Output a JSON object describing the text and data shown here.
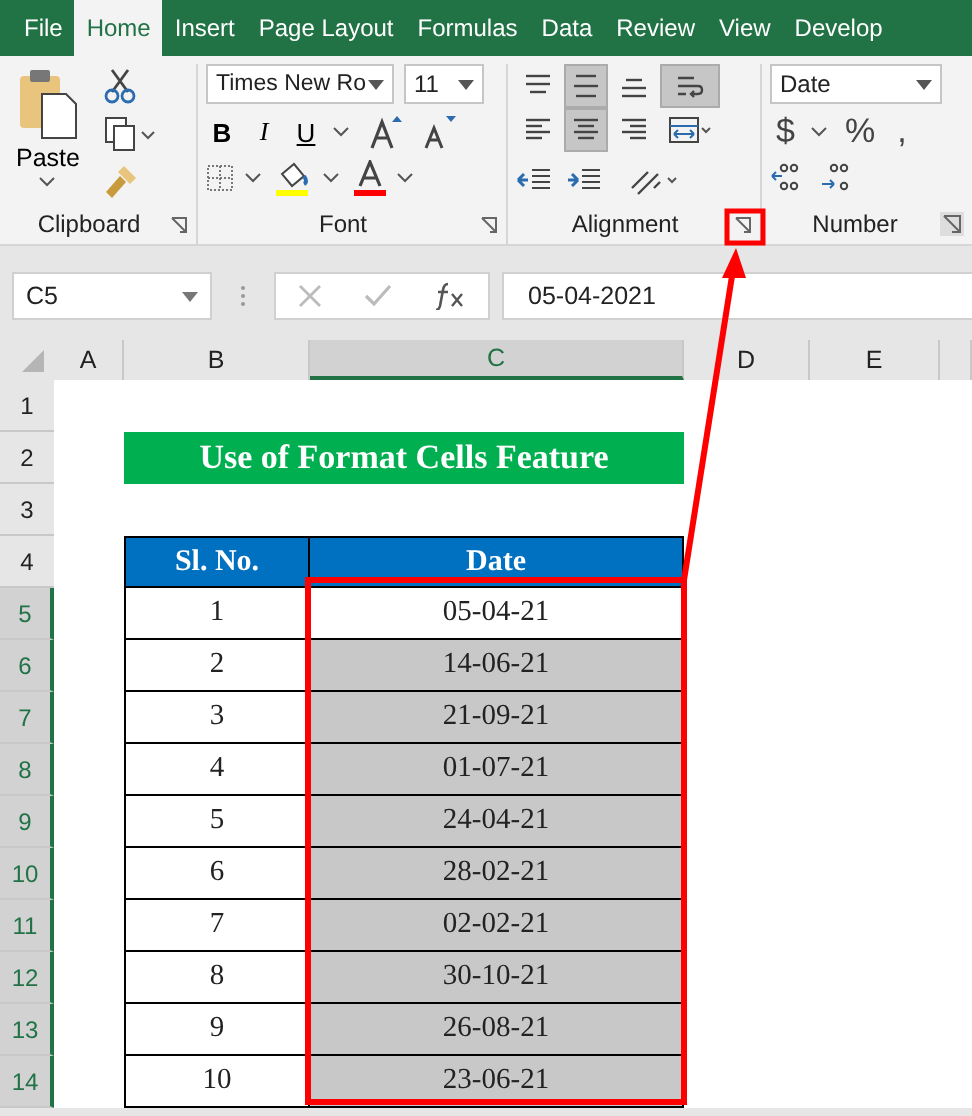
{
  "tabs": [
    {
      "label": "File",
      "selected": false
    },
    {
      "label": "Home",
      "selected": true
    },
    {
      "label": "Insert",
      "selected": false
    },
    {
      "label": "Page Layout",
      "selected": false
    },
    {
      "label": "Formulas",
      "selected": false
    },
    {
      "label": "Data",
      "selected": false
    },
    {
      "label": "Review",
      "selected": false
    },
    {
      "label": "View",
      "selected": false
    },
    {
      "label": "Develop",
      "selected": false
    }
  ],
  "ribbon": {
    "clipboard": {
      "paste_label": "Paste",
      "label": "Clipboard"
    },
    "font": {
      "font_name": "Times New Ro",
      "font_size": "11",
      "bold": "B",
      "italic": "I",
      "underline": "U",
      "label": "Font"
    },
    "alignment": {
      "label": "Alignment",
      "buttons": [
        {
          "kind": "top",
          "selected": false
        },
        {
          "kind": "middle",
          "selected": true
        },
        {
          "kind": "bottom",
          "selected": false
        },
        {
          "kind": "wrap",
          "selected": true
        },
        {
          "kind": "left",
          "selected": false
        },
        {
          "kind": "center",
          "selected": true
        },
        {
          "kind": "right",
          "selected": false
        },
        {
          "kind": "merge",
          "selected": false
        }
      ]
    },
    "number": {
      "format": "Date",
      "currency": "$",
      "percent": "%",
      "comma": ",",
      "label": "Number"
    }
  },
  "formula_bar": {
    "name_box": "C5",
    "formula": "05-04-2021"
  },
  "columns": [
    {
      "label": "A",
      "selected": false
    },
    {
      "label": "B",
      "selected": false
    },
    {
      "label": "C",
      "selected": true
    },
    {
      "label": "D",
      "selected": false
    },
    {
      "label": "E",
      "selected": false
    }
  ],
  "row_numbers": [
    {
      "label": "1",
      "selected": false
    },
    {
      "label": "2",
      "selected": false
    },
    {
      "label": "3",
      "selected": false
    },
    {
      "label": "4",
      "selected": false
    },
    {
      "label": "5",
      "selected": true
    },
    {
      "label": "6",
      "selected": true
    },
    {
      "label": "7",
      "selected": true
    },
    {
      "label": "8",
      "selected": true
    },
    {
      "label": "9",
      "selected": true
    },
    {
      "label": "10",
      "selected": true
    },
    {
      "label": "11",
      "selected": true
    },
    {
      "label": "12",
      "selected": true
    },
    {
      "label": "13",
      "selected": true
    },
    {
      "label": "14",
      "selected": true
    }
  ],
  "title": "Use of Format Cells Feature",
  "table": {
    "headers": [
      "Sl. No.",
      "Date"
    ],
    "rows": [
      {
        "sl": "1",
        "date": "05-04-21",
        "active": true
      },
      {
        "sl": "2",
        "date": "14-06-21",
        "active": false
      },
      {
        "sl": "3",
        "date": "21-09-21",
        "active": false
      },
      {
        "sl": "4",
        "date": "01-07-21",
        "active": false
      },
      {
        "sl": "5",
        "date": "24-04-21",
        "active": false
      },
      {
        "sl": "6",
        "date": "28-02-21",
        "active": false
      },
      {
        "sl": "7",
        "date": "02-02-21",
        "active": false
      },
      {
        "sl": "8",
        "date": "30-10-21",
        "active": false
      },
      {
        "sl": "9",
        "date": "26-08-21",
        "active": false
      },
      {
        "sl": "10",
        "date": "23-06-21",
        "active": false
      }
    ]
  }
}
